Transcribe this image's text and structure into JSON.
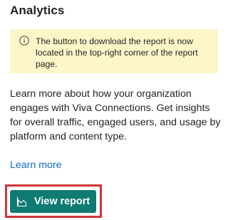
{
  "panel": {
    "title": "Analytics"
  },
  "notice": {
    "icon": "info-icon",
    "text": "The button to download the report is now located in the top-right corner of the report page.",
    "background": "#fdf6c9"
  },
  "description": "Learn more about how your organization engages with Viva Connections. Get insights for overall traffic, engaged users, and usage by platform and content type.",
  "links": {
    "learn_more": "Learn more"
  },
  "actions": {
    "view_report_label": "View report",
    "view_report_icon": "area-chart-icon",
    "button_color": "#0f7b72",
    "highlight_color": "#d13438"
  }
}
